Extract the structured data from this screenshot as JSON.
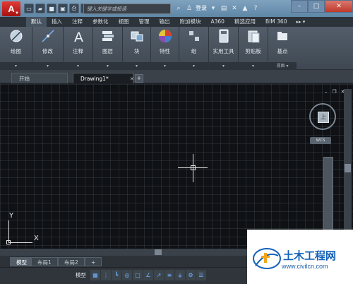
{
  "titlebar": {
    "search_placeholder": "键入关键字或短语",
    "login_label": "登录",
    "help_label": "?"
  },
  "ribbon_tabs": [
    "默认",
    "插入",
    "注释",
    "参数化",
    "视图",
    "管理",
    "输出",
    "附加模块",
    "A360",
    "精选应用",
    "BIM 360"
  ],
  "ribbon_tab_active": "默认",
  "ribbon_groups": [
    {
      "label": "绘图"
    },
    {
      "label": "修改"
    },
    {
      "label": "注释"
    },
    {
      "label": "图层"
    },
    {
      "label": "块"
    },
    {
      "label": "特性"
    },
    {
      "label": "组"
    },
    {
      "label": "实用工具"
    },
    {
      "label": "剪贴板"
    },
    {
      "label": "基点"
    }
  ],
  "ribbon_footer_view": "视图",
  "file_tabs": [
    {
      "label": "开始"
    },
    {
      "label": "Drawing1*"
    }
  ],
  "add_tab_label": "+",
  "viewcube": {
    "face_label": "上",
    "wcs_label": "WCS"
  },
  "ucs": {
    "x_label": "X",
    "y_label": "Y"
  },
  "layout_tabs": [
    {
      "label": "模型"
    },
    {
      "label": "布局1"
    },
    {
      "label": "布局2"
    }
  ],
  "statusbar": {
    "model_label": "模型"
  },
  "watermark": {
    "title": "土木工程网",
    "url": "www.civilcn.com"
  },
  "colors": {
    "accent": "#d32f2f",
    "canvas": "#0f1114",
    "ribbon": "#4a5562",
    "watermark_blue": "#1361b8"
  }
}
